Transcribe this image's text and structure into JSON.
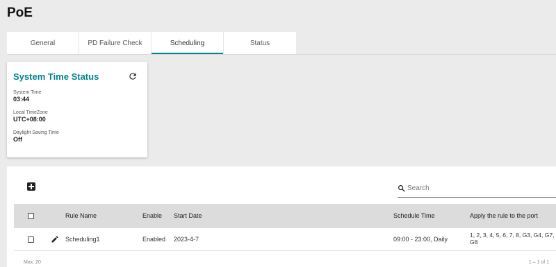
{
  "page": {
    "title": "PoE"
  },
  "tabs": [
    {
      "label": "General"
    },
    {
      "label": "PD Failure Check"
    },
    {
      "label": "Scheduling"
    },
    {
      "label": "Status"
    }
  ],
  "active_tab": "Scheduling",
  "system_time": {
    "title": "System Time Status",
    "refresh_icon": "refresh-icon",
    "fields": [
      {
        "label": "System Time",
        "value": "03:44"
      },
      {
        "label": "Local TimeZone",
        "value": "UTC+08:00"
      },
      {
        "label": "Daylight Saving Time",
        "value": "Off"
      }
    ]
  },
  "table": {
    "add_icon": "add-box-icon",
    "search_placeholder": "Search",
    "columns": {
      "rule_name": "Rule Name",
      "enable": "Enable",
      "start_date": "Start Date",
      "schedule_time": "Schedule Time",
      "apply": "Apply the rule to the port"
    },
    "rows": [
      {
        "rule_name": "Scheduling1",
        "enable": "Enabled",
        "start_date": "2023-4-7",
        "schedule_time": "09:00 - 23:00, Daily",
        "apply": "1, 2, 3, 4, 5, 6, 7, 8, G3, G4, G7, G8"
      }
    ],
    "footer_left": "Max. 20",
    "footer_right": "1 – 1 of 1"
  },
  "colors": {
    "accent": "#00838f",
    "header_bg": "#dcdcdc",
    "page_bg": "#ebebeb"
  }
}
